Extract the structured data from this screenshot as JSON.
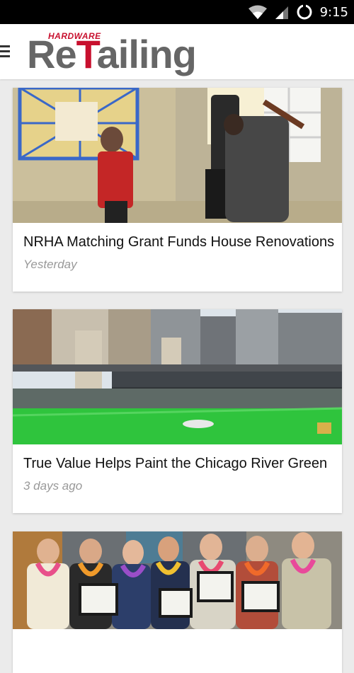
{
  "status_bar": {
    "time": "9:15",
    "icons": [
      "wifi-icon",
      "cell-signal-icon",
      "sync-icon"
    ]
  },
  "header": {
    "menu_icon": "hamburger-icon",
    "logo_small": "HARDWARE",
    "logo_big_prefix": "Re",
    "logo_big_red": "T",
    "logo_big_suffix": "ailing"
  },
  "articles": [
    {
      "title": "NRHA Matching Grant Funds House Renovations",
      "date": "Yesterday",
      "image": "house-renovation-photo"
    },
    {
      "title": "True Value Helps Paint the Chicago River Green",
      "date": "3 days ago",
      "image": "chicago-river-photo"
    },
    {
      "title": "",
      "date": "",
      "image": "award-group-photo"
    }
  ],
  "colors": {
    "brand_red": "#c8102e",
    "logo_gray": "#666666",
    "background": "#ebebeb"
  }
}
